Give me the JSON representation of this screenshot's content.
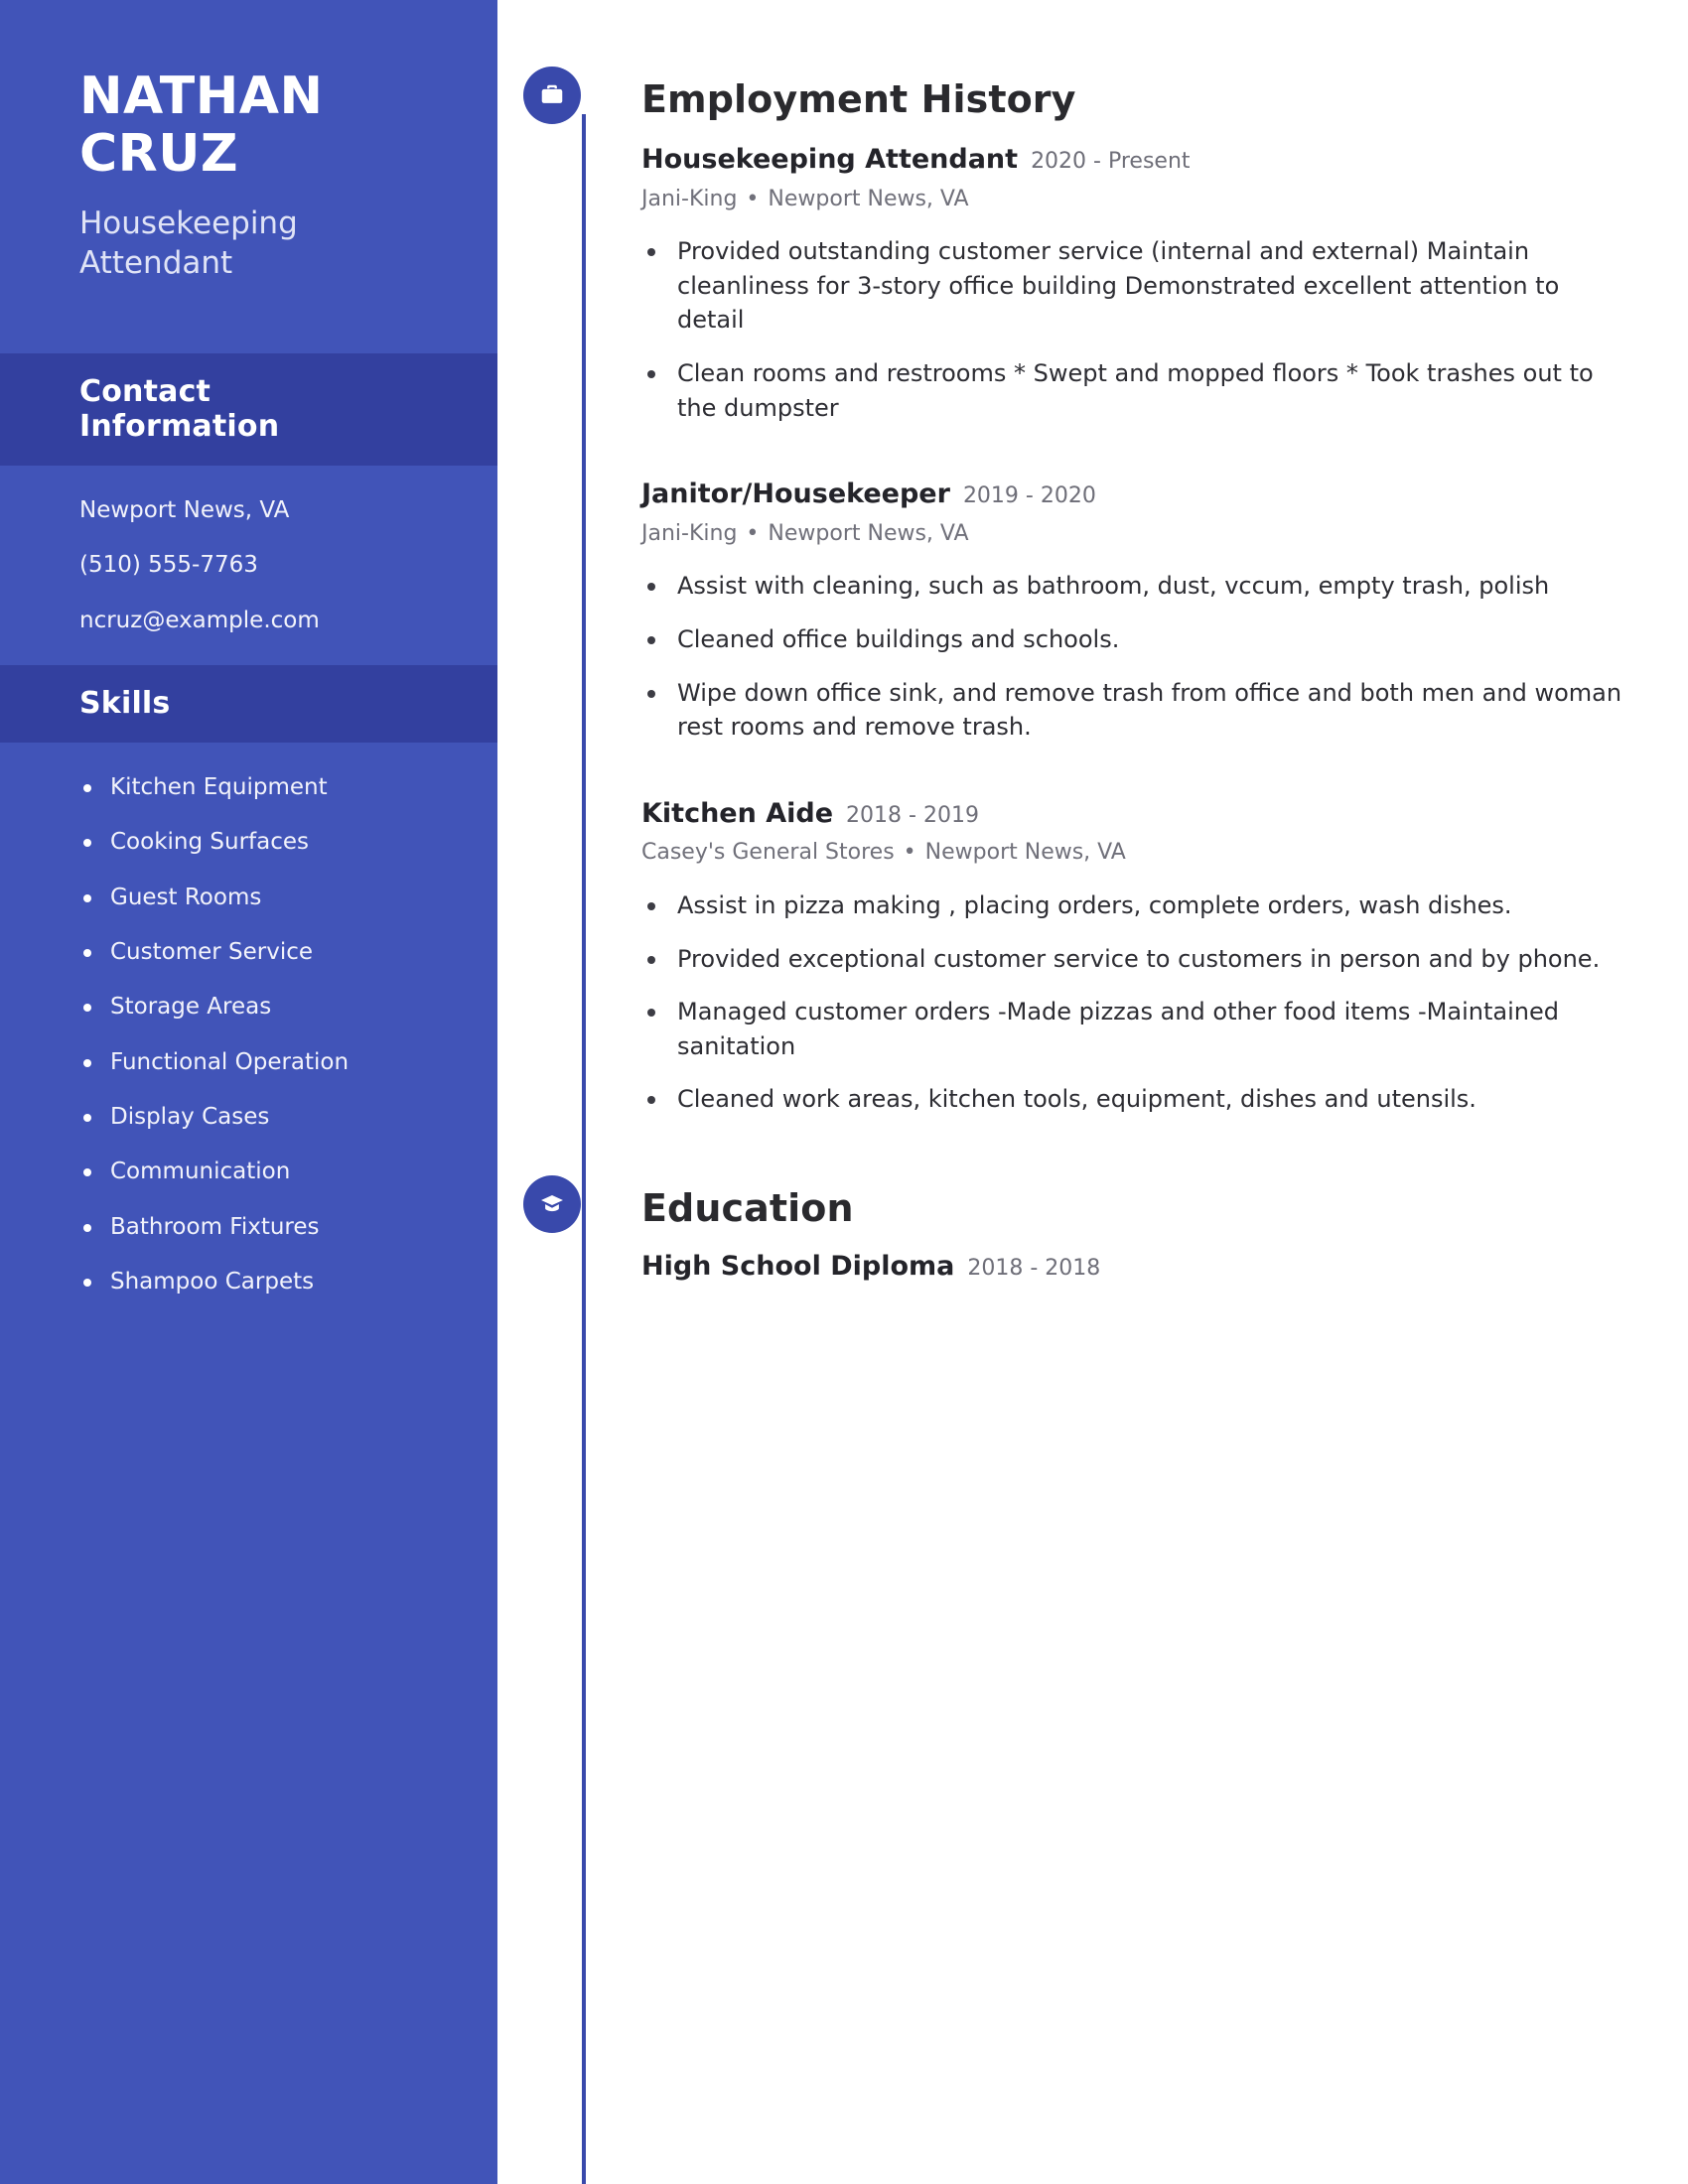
{
  "colors": {
    "sidebar_bg": "#4154b8",
    "sidebar_header_bg": "#33409f",
    "accent": "#3949ab",
    "text_dark": "#2a2a2e",
    "text_muted": "#70707a"
  },
  "sidebar": {
    "first_name": "NATHAN",
    "last_name": "CRUZ",
    "job_title": "Housekeeping Attendant",
    "contact": {
      "heading": "Contact Information",
      "items": [
        "Newport News, VA",
        "(510) 555-7763",
        "ncruz@example.com"
      ]
    },
    "skills": {
      "heading": "Skills",
      "items": [
        "Kitchen Equipment",
        "Cooking Surfaces",
        "Guest Rooms",
        "Customer Service",
        "Storage Areas",
        "Functional Operation",
        "Display Cases",
        "Communication",
        "Bathroom Fixtures",
        "Shampoo Carpets"
      ]
    }
  },
  "main": {
    "employment": {
      "heading": "Employment History",
      "icon": "briefcase-icon",
      "jobs": [
        {
          "role": "Housekeeping Attendant",
          "dates": "2020 - Present",
          "company": "Jani-King",
          "location": "Newport News, VA",
          "separator": "•",
          "bullets": [
            "Provided outstanding customer service (internal and external) Maintain cleanliness for 3-story office building Demonstrated excellent attention to detail",
            "Clean rooms and restrooms * Swept and mopped floors * Took trashes out to the dumpster"
          ]
        },
        {
          "role": "Janitor/Housekeeper",
          "dates": "2019 - 2020",
          "company": "Jani-King",
          "location": "Newport News, VA",
          "separator": "•",
          "bullets": [
            "Assist with cleaning, such as bathroom, dust, vccum, empty trash, polish",
            "Cleaned office buildings and schools.",
            "Wipe down office sink, and remove trash from office and both men and woman rest rooms and remove trash."
          ]
        },
        {
          "role": "Kitchen Aide",
          "dates": "2018 - 2019",
          "company": "Casey's General Stores",
          "location": "Newport News, VA",
          "separator": "•",
          "bullets": [
            "Assist in pizza making , placing orders, complete orders, wash dishes.",
            "Provided exceptional customer service to customers in person and by phone.",
            "Managed customer orders -Made pizzas and other food items -Maintained sanitation",
            "Cleaned work areas, kitchen tools, equipment, dishes and utensils."
          ]
        }
      ]
    },
    "education": {
      "heading": "Education",
      "icon": "graduation-cap-icon",
      "entries": [
        {
          "degree": "High School Diploma",
          "dates": "2018 - 2018"
        }
      ]
    }
  }
}
